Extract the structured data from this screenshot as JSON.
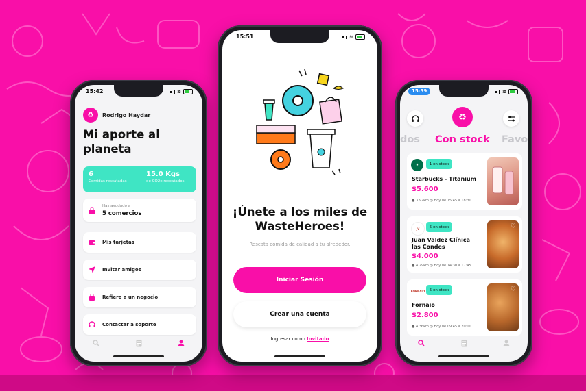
{
  "colors": {
    "brand": "#f90fa8",
    "accent": "#3fe5c4",
    "badge": "#3fe5c4"
  },
  "left_phone": {
    "time": "15:42",
    "user_name": "Rodrigo Haydar",
    "title": "Mi aporte al planeta",
    "stats": [
      {
        "value": "6",
        "label": "Comidas rescatadas"
      },
      {
        "value": "15.0 Kgs",
        "label": "de CO2e rescatados"
      }
    ],
    "helped": {
      "caption": "Has ayudado a",
      "value": "5 comercios"
    },
    "menu": [
      {
        "label": "Mis tarjetas",
        "icon": "wallet-icon"
      },
      {
        "label": "Invitar amigos",
        "icon": "send-icon"
      },
      {
        "label": "Refiere a un negocio",
        "icon": "shopping-bag-icon"
      },
      {
        "label": "Contactar a soporte",
        "icon": "headset-icon"
      }
    ]
  },
  "center_phone": {
    "time": "15:51",
    "headline": "¡Únete a los miles de WasteHeroes!",
    "subtitle": "Rescata comida de calidad a tu alrededor.",
    "login_label": "Iniciar Sesión",
    "signup_label": "Crear una cuenta",
    "guest_prefix": "Ingresar como",
    "guest_link": "Invitado"
  },
  "right_phone": {
    "time": "15:39",
    "tabs": [
      "odos",
      "Con stock",
      "Favo"
    ],
    "shops": [
      {
        "name": "Starbucks - Titanium",
        "badge": "1 en stock",
        "price": "$5.600",
        "distance": "3.92km",
        "time": "Hoy de 15:45 a 18:30",
        "logo": "Starbucks"
      },
      {
        "name": "Juan Valdez Clínica las Condes",
        "badge": "5 en stock",
        "price": "$4.000",
        "distance": "4.29km",
        "time": "Hoy de 14:30 a 17:45",
        "logo": "Juan Valdez"
      },
      {
        "name": "Fornaio",
        "badge": "5 en stock",
        "price": "$2.800",
        "distance": "4.36km",
        "time": "Hoy de 09:45 a 20:00",
        "logo": "FORNAIO"
      }
    ]
  }
}
